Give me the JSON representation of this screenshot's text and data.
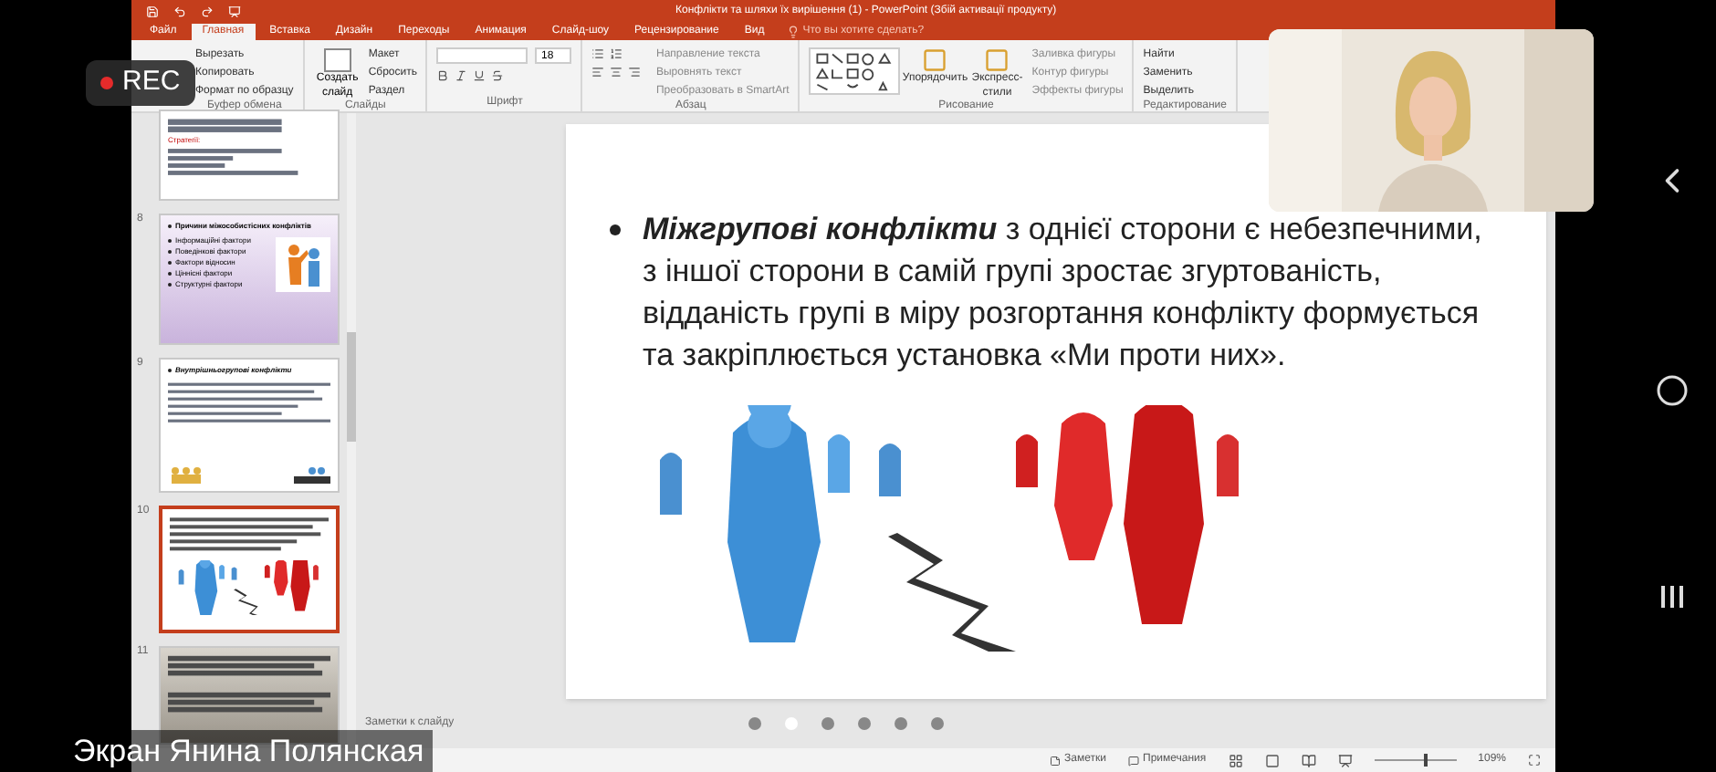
{
  "window": {
    "title": "Конфлікти та шляхи їх вирішення (1) - PowerPoint (Збій активації продукту)"
  },
  "tabs": [
    {
      "label": "Файл",
      "selected": false
    },
    {
      "label": "Главная",
      "selected": true
    },
    {
      "label": "Вставка",
      "selected": false
    },
    {
      "label": "Дизайн",
      "selected": false
    },
    {
      "label": "Переходы",
      "selected": false
    },
    {
      "label": "Анимация",
      "selected": false
    },
    {
      "label": "Слайд-шоу",
      "selected": false
    },
    {
      "label": "Рецензирование",
      "selected": false
    },
    {
      "label": "Вид",
      "selected": false
    }
  ],
  "tell_me": {
    "placeholder": "Что вы хотите сделать?"
  },
  "ribbon": [
    {
      "kind": "buttons",
      "label": "Буфер обмена",
      "items": [
        "Вырезать",
        "Копировать",
        "Формат по образцу"
      ]
    },
    {
      "kind": "buttons",
      "label": "Слайды",
      "big": [
        "Создать слайд"
      ],
      "items": [
        "Макет",
        "Сбросить",
        "Раздел"
      ]
    },
    {
      "kind": "font",
      "label": "Шрифт",
      "font_size": "18"
    },
    {
      "kind": "paragraph",
      "label": "Абзац",
      "items": [
        "Направление текста",
        "Выровнять текст",
        "Преобразовать в SmartArt"
      ]
    },
    {
      "kind": "drawing",
      "label": "Рисование",
      "big": [
        "Упорядочить",
        "Экспресс-стили"
      ],
      "items": [
        "Заливка фигуры",
        "Контур фигуры",
        "Эффекты фигуры"
      ]
    },
    {
      "kind": "buttons",
      "label": "Редактирование",
      "items": [
        "Найти",
        "Заменить",
        "Выделить"
      ]
    }
  ],
  "thumbnails": [
    {
      "kind": "list",
      "heading": "Стратегії:",
      "selected": false
    },
    {
      "kind": "bullets",
      "number": "8",
      "title": "Причини міжособистісних конфліктів",
      "bullets": [
        "Інформаційні фактори",
        "Поведінкові фактори",
        "Фактори відносин",
        "Ціннісні фактори",
        "Структурні фактори"
      ],
      "selected": false
    },
    {
      "kind": "text",
      "number": "9",
      "title": "Внутрішньогрупові конфлікти",
      "selected": false
    },
    {
      "kind": "current",
      "number": "10",
      "selected": true
    },
    {
      "kind": "dark",
      "number": "11",
      "selected": false
    }
  ],
  "slide": {
    "bullet": "**Міжгрупові конфлікти**  з однієї сторони є небезпечними, з іншої сторони в самій групі зростає згуртованість, відданість групі в міру розгортання конфлікту формується та закріплюється установка «Ми проти них»."
  },
  "notes_placeholder": "Заметки к слайду",
  "pager": [
    {
      "selected": false
    },
    {
      "selected": true
    },
    {
      "selected": false
    },
    {
      "selected": false
    },
    {
      "selected": false
    },
    {
      "selected": false
    }
  ],
  "status_bar": {
    "notes": "Заметки",
    "comments": "Примечания",
    "zoom_slider": {
      "level": 0.6
    },
    "zoom": "109%"
  },
  "recording": {
    "label": "REC"
  },
  "caption": "Экран Янина Полянская"
}
